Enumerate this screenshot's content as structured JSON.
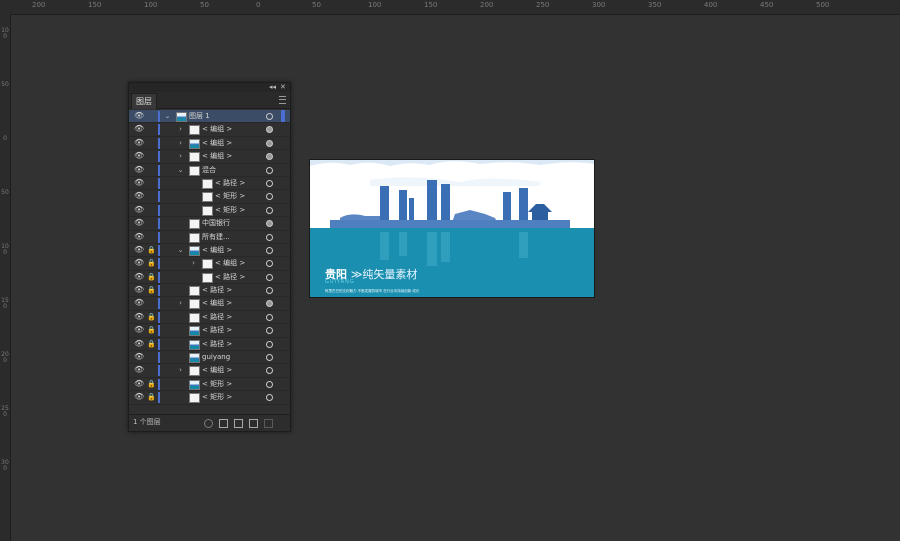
{
  "ruler": {
    "top_labels": [
      "200",
      "150",
      "100",
      "50",
      "0",
      "50",
      "100",
      "150",
      "200",
      "250",
      "300",
      "350",
      "400",
      "450",
      "500"
    ],
    "left_labels": [
      "100",
      "50",
      "0",
      "50",
      "100",
      "150",
      "200",
      "250",
      "300"
    ]
  },
  "panel": {
    "tab": "图层",
    "collapse_glyph": "◂◂",
    "close_glyph": "✕",
    "footer_count": "1 个图层",
    "rows": [
      {
        "name": "图层 1",
        "depth": 0,
        "expand": "open",
        "thumb": "art",
        "lock": false,
        "sel": true
      },
      {
        "name": "< 编组 >",
        "depth": 1,
        "expand": "closed",
        "thumb": "white",
        "lock": false
      },
      {
        "name": "< 编组 >",
        "depth": 1,
        "expand": "closed",
        "thumb": "art",
        "lock": false
      },
      {
        "name": "< 编组 >",
        "depth": 1,
        "expand": "closed",
        "thumb": "white",
        "lock": false
      },
      {
        "name": "混合",
        "depth": 1,
        "expand": "open",
        "thumb": "white",
        "lock": false
      },
      {
        "name": "< 路径 >",
        "depth": 2,
        "expand": "none",
        "thumb": "white",
        "lock": false
      },
      {
        "name": "< 矩形 >",
        "depth": 2,
        "expand": "none",
        "thumb": "white",
        "lock": false
      },
      {
        "name": "< 矩形 >",
        "depth": 2,
        "expand": "none",
        "thumb": "white",
        "lock": false
      },
      {
        "name": "中国银行",
        "depth": 1,
        "expand": "none",
        "thumb": "white",
        "lock": false
      },
      {
        "name": "所有建...",
        "depth": 1,
        "expand": "none",
        "thumb": "white",
        "lock": false
      },
      {
        "name": "< 编组 >",
        "depth": 1,
        "expand": "open",
        "thumb": "art",
        "lock": true
      },
      {
        "name": "< 编组 >",
        "depth": 2,
        "expand": "closed",
        "thumb": "white",
        "lock": true
      },
      {
        "name": "< 路径 >",
        "depth": 2,
        "expand": "none",
        "thumb": "white",
        "lock": true
      },
      {
        "name": "< 路径 >",
        "depth": 1,
        "expand": "none",
        "thumb": "white",
        "lock": true
      },
      {
        "name": "< 编组 >",
        "depth": 1,
        "expand": "closed",
        "thumb": "white",
        "lock": false
      },
      {
        "name": "< 路径 >",
        "depth": 1,
        "expand": "none",
        "thumb": "white",
        "lock": true
      },
      {
        "name": "< 路径 >",
        "depth": 1,
        "expand": "none",
        "thumb": "art",
        "lock": true
      },
      {
        "name": "< 路径 >",
        "depth": 1,
        "expand": "none",
        "thumb": "art",
        "lock": true
      },
      {
        "name": "guiyang",
        "depth": 1,
        "expand": "none",
        "thumb": "art",
        "lock": false
      },
      {
        "name": "< 编组 >",
        "depth": 1,
        "expand": "closed",
        "thumb": "white",
        "lock": false
      },
      {
        "name": "< 矩形 >",
        "depth": 1,
        "expand": "none",
        "thumb": "art",
        "lock": true
      },
      {
        "name": "< 矩形 >",
        "depth": 1,
        "expand": "none",
        "thumb": "white",
        "lock": true
      }
    ]
  },
  "artboard": {
    "title_main": "贵阳",
    "title_sub": "≫纯矢量素材",
    "title_en": "GUIYANG",
    "tagline": "阿里巴巴的文化魅力 不断发展的城市 在行业中持续创新 成长"
  },
  "colors": {
    "accent": "#4a6fd1",
    "sky": "#ffffff",
    "skyline": "#3a6fb5",
    "water": "#1b8fb0"
  }
}
